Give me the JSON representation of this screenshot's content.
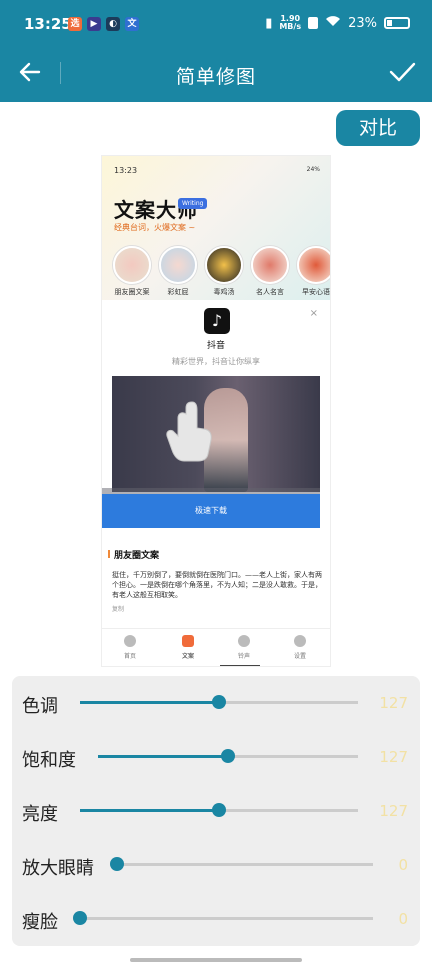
{
  "status_bar": {
    "time": "13:25",
    "net_speed_value": "1.90",
    "net_speed_unit": "MB/s",
    "battery": "23%"
  },
  "nav": {
    "title": "简单修图",
    "back_icon": "back-arrow-icon",
    "confirm_icon": "check-icon"
  },
  "compare_button": "对比",
  "preview": {
    "status_time": "13:23",
    "status_battery": "24%",
    "app_name": "文案大师",
    "badge": "Writing",
    "slogan": "经典台词，火爆文案 ~",
    "categories": [
      "朋友圈文案",
      "彩虹屁",
      "毒鸡汤",
      "名人名言",
      "早安心语"
    ],
    "ad": {
      "app": "抖音",
      "tagline": "精彩世界，抖音让你纵享",
      "download": "极速下载",
      "close": "×"
    },
    "section_title": "朋友圈文案",
    "quote": "挺住，千万别倒了，要倒就倒在医院门口。——老人上街，家人有两个担心。一是跌倒在哪个角落里，不为人知；二是没人敢救。于是，有老人这般互相取笑。",
    "copy_label": "复制",
    "tabs": [
      "首页",
      "文案",
      "铃声",
      "设置"
    ],
    "active_tab": "文案"
  },
  "adjustments": [
    {
      "label": "色调",
      "value": "127",
      "fraction": 0.5
    },
    {
      "label": "饱和度",
      "value": "127",
      "fraction": 0.5
    },
    {
      "label": "亮度",
      "value": "127",
      "fraction": 0.5
    },
    {
      "label": "放大眼睛",
      "value": "0",
      "fraction": 0.0
    },
    {
      "label": "瘦脸",
      "value": "0",
      "fraction": 0.0
    }
  ],
  "colors": {
    "accent": "#1a86a3",
    "value_text": "#f2e1a4",
    "panel_bg": "#eeeeee"
  }
}
